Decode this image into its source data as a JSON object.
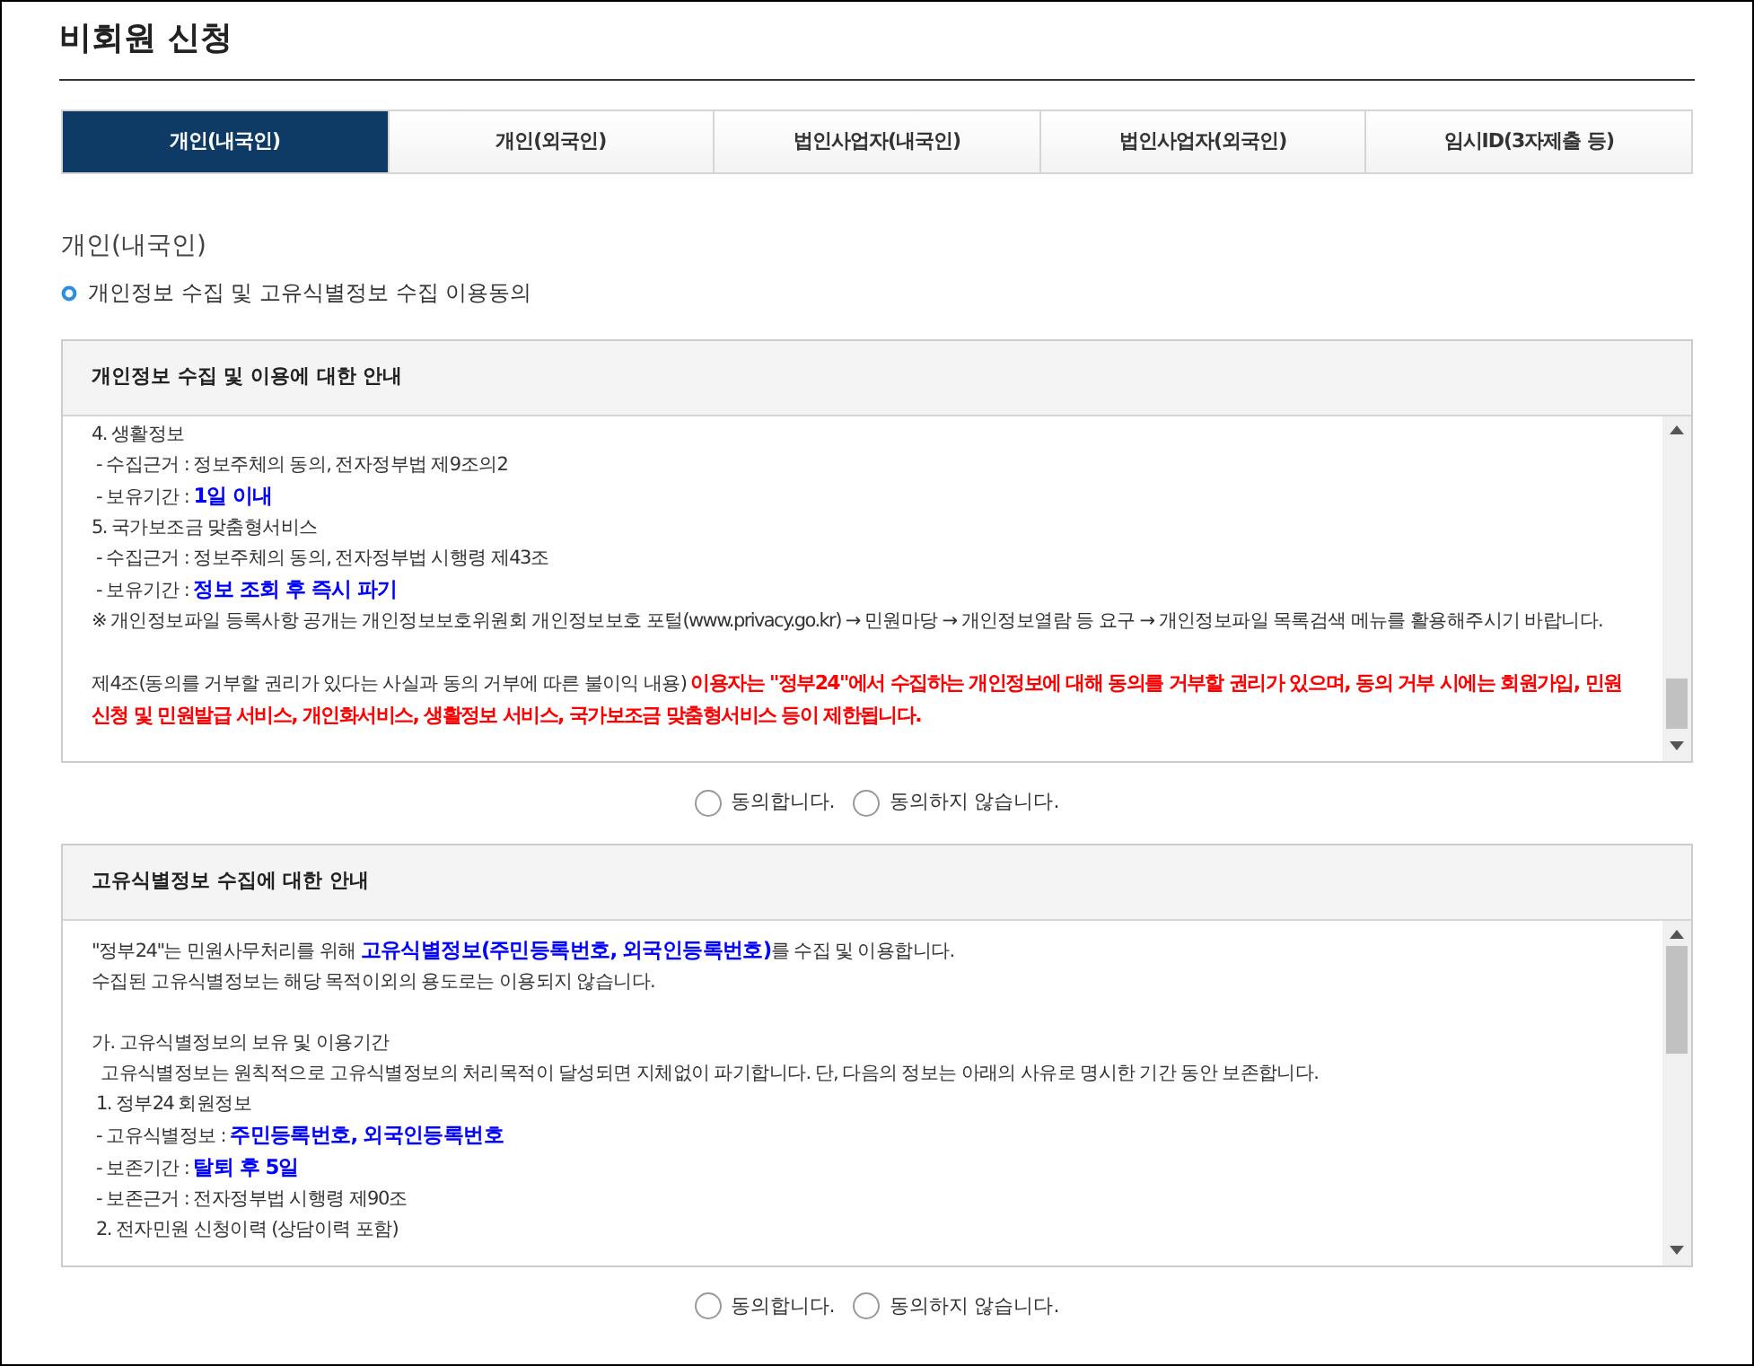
{
  "page": {
    "title": "비회원 신청"
  },
  "tabs": [
    {
      "label": "개인(내국인)",
      "selected": true
    },
    {
      "label": "개인(외국인)",
      "selected": false
    },
    {
      "label": "법인사업자(내국인)",
      "selected": false
    },
    {
      "label": "법인사업자(외국인)",
      "selected": false
    },
    {
      "label": "임시ID(3자제출 등)",
      "selected": false
    }
  ],
  "section_title": "개인(내국인)",
  "consent_heading": "개인정보 수집 및 고유식별정보 수집 이용동의",
  "panels": [
    {
      "title": "개인정보 수집 및 이용에 대한 안내",
      "lines": [
        {
          "kind": "text",
          "segments": [
            {
              "text": "4. 생활정보",
              "kind": "plain"
            }
          ]
        },
        {
          "kind": "text",
          "segments": [
            {
              "text": " - 수집근거 : 정보주체의 동의, 전자정부법 제9조의2",
              "kind": "plain"
            }
          ]
        },
        {
          "kind": "text",
          "segments": [
            {
              "text": " - 보유기간 : ",
              "kind": "plain"
            },
            {
              "text": "1일 이내",
              "kind": "emphasis"
            }
          ]
        },
        {
          "kind": "text",
          "segments": [
            {
              "text": "5. 국가보조금 맞춤형서비스",
              "kind": "plain"
            }
          ]
        },
        {
          "kind": "text",
          "segments": [
            {
              "text": " - 수집근거 : 정보주체의 동의, 전자정부법 시행령 제43조",
              "kind": "plain"
            }
          ]
        },
        {
          "kind": "text",
          "segments": [
            {
              "text": " - 보유기간 : ",
              "kind": "plain"
            },
            {
              "text": "정보 조회 후 즉시 파기",
              "kind": "emphasis"
            }
          ]
        },
        {
          "kind": "text",
          "segments": [
            {
              "text": "※ 개인정보파일 등록사항 공개는 개인정보보호위원회 개인정보보호 포털(www.privacy.go.kr) → 민원마당 → 개인정보열람 등 요구 → 개인정보파일 목록검색 메뉴를 활용해주시기 바랍니다.",
              "kind": "plain"
            }
          ]
        },
        {
          "kind": "blank"
        },
        {
          "kind": "text",
          "segments": [
            {
              "text": "제4조(동의를 거부할 권리가 있다는 사실과 동의 거부에 따른 불이익 내용) ",
              "kind": "plain"
            },
            {
              "text": "이용자는 \"정부24\"에서 수집하는 개인정보에 대해 동의를 거부할 권리가 있으며, 동의 거부 시에는 회원가입, 민원신청 및 민원발급 서비스, 개인화서비스, 생활정보 서비스, 국가보조금 맞춤형서비스 등이 제한됩니다.",
              "kind": "warning"
            }
          ]
        }
      ],
      "options": [
        {
          "label": "동의합니다.",
          "selected": false
        },
        {
          "label": "동의하지 않습니다.",
          "selected": false
        }
      ]
    },
    {
      "title": "고유식별정보 수집에 대한 안내",
      "lines": [
        {
          "kind": "text",
          "segments": [
            {
              "text": "\"정부24\"는 민원사무처리를 위해 ",
              "kind": "plain"
            },
            {
              "text": "고유식별정보(주민등록번호, 외국인등록번호)",
              "kind": "emphasis"
            },
            {
              "text": "를 수집 및 이용합니다.",
              "kind": "plain"
            }
          ]
        },
        {
          "kind": "text",
          "segments": [
            {
              "text": "수집된 고유식별정보는 해당 목적이외의 용도로는 이용되지 않습니다.",
              "kind": "plain"
            }
          ]
        },
        {
          "kind": "blank"
        },
        {
          "kind": "text",
          "segments": [
            {
              "text": "가. 고유식별정보의 보유 및 이용기간",
              "kind": "plain"
            }
          ]
        },
        {
          "kind": "text",
          "segments": [
            {
              "text": "  고유식별정보는 원칙적으로 고유식별정보의 처리목적이 달성되면 지체없이 파기합니다. 단, 다음의 정보는 아래의 사유로 명시한 기간 동안 보존합니다.",
              "kind": "plain"
            }
          ]
        },
        {
          "kind": "text",
          "segments": [
            {
              "text": " 1. 정부24 회원정보",
              "kind": "plain"
            }
          ]
        },
        {
          "kind": "text",
          "segments": [
            {
              "text": " - 고유식별정보 : ",
              "kind": "plain"
            },
            {
              "text": "주민등록번호, 외국인등록번호",
              "kind": "emphasis"
            }
          ]
        },
        {
          "kind": "text",
          "segments": [
            {
              "text": " - 보존기간 : ",
              "kind": "plain"
            },
            {
              "text": "탈퇴 후 5일",
              "kind": "emphasis"
            }
          ]
        },
        {
          "kind": "text",
          "segments": [
            {
              "text": " - 보존근거 : 전자정부법 시행령 제90조",
              "kind": "plain"
            }
          ]
        },
        {
          "kind": "text",
          "segments": [
            {
              "text": " 2. 전자민원 신청이력 (상담이력 포함)",
              "kind": "plain"
            }
          ]
        }
      ],
      "options": [
        {
          "label": "동의합니다.",
          "selected": false
        },
        {
          "label": "동의하지 않습니다.",
          "selected": false
        }
      ]
    }
  ]
}
